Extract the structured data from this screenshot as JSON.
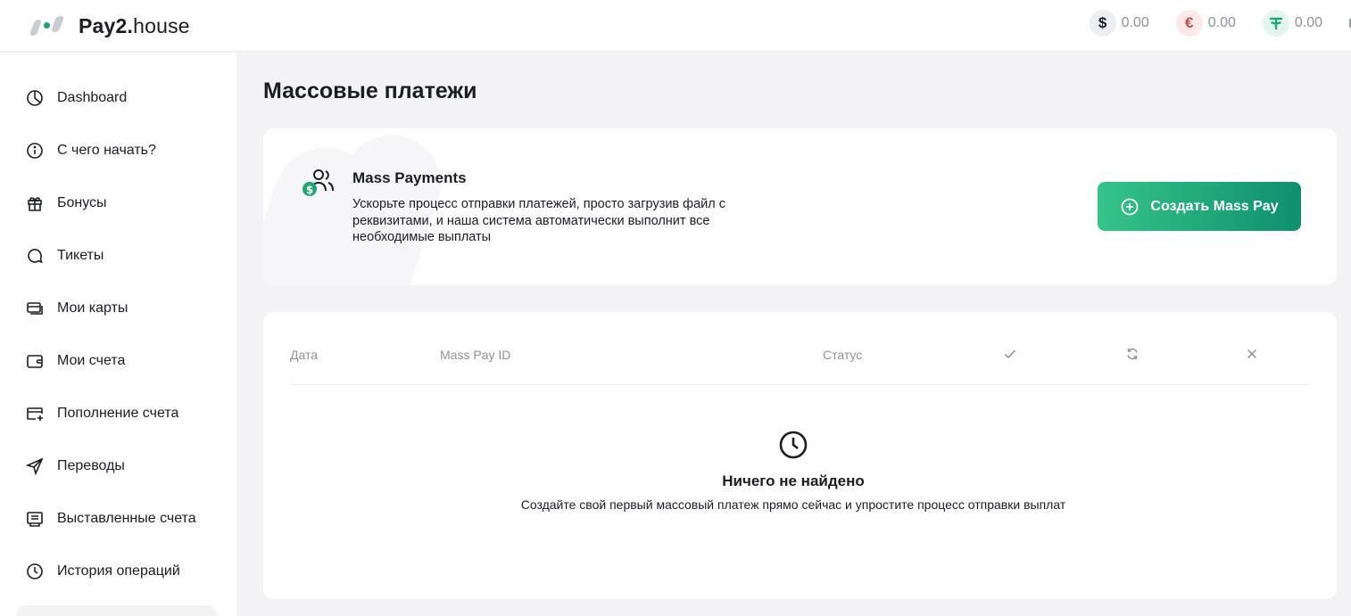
{
  "app": {
    "logo_brand": "Pay2.",
    "logo_suffix": "house"
  },
  "balances": [
    {
      "currency": "USD",
      "symbol": "$",
      "value": "0.00",
      "icon": "dollar-icon"
    },
    {
      "currency": "EUR",
      "symbol": "€",
      "value": "0.00",
      "icon": "euro-icon"
    },
    {
      "currency": "USDT",
      "symbol": "T",
      "value": "0.00",
      "icon": "tether-icon"
    }
  ],
  "sidebar": {
    "items": [
      {
        "label": "Dashboard",
        "icon": "pie-chart-icon"
      },
      {
        "label": "С чего начать?",
        "icon": "info-icon"
      },
      {
        "label": "Бонусы",
        "icon": "gift-icon"
      },
      {
        "label": "Тикеты",
        "icon": "chat-bubble-icon"
      },
      {
        "label": "Мои карты",
        "icon": "cards-icon"
      },
      {
        "label": "Мои счета",
        "icon": "wallet-icon"
      },
      {
        "label": "Пополнение счета",
        "icon": "card-add-icon"
      },
      {
        "label": "Переводы",
        "icon": "send-icon"
      },
      {
        "label": "Выставленные счета",
        "icon": "invoice-icon"
      },
      {
        "label": "История операций",
        "icon": "clock-icon"
      }
    ]
  },
  "page": {
    "title": "Массовые платежи"
  },
  "mass_pay_card": {
    "title": "Mass Payments",
    "description": "Ускорьте процесс отправки платежей, просто загрузив файл с реквизитами, и наша система автоматически выполнит все необходимые выплаты",
    "button_label": "Создать Mass Pay"
  },
  "table": {
    "columns": [
      "Дата",
      "Mass Pay ID",
      "Статус"
    ],
    "icon_columns": [
      "check-icon",
      "refresh-icon",
      "close-icon"
    ],
    "empty_title": "Ничего не найдено",
    "empty_description": "Создайте свой первый массовый платеж прямо сейчас и упростите процесс отправки выплат"
  },
  "colors": {
    "accent_start": "#35c488",
    "accent_end": "#0f8f6e",
    "text": "#1a1d24",
    "muted": "#8d929b",
    "background": "#f3f3f5"
  }
}
